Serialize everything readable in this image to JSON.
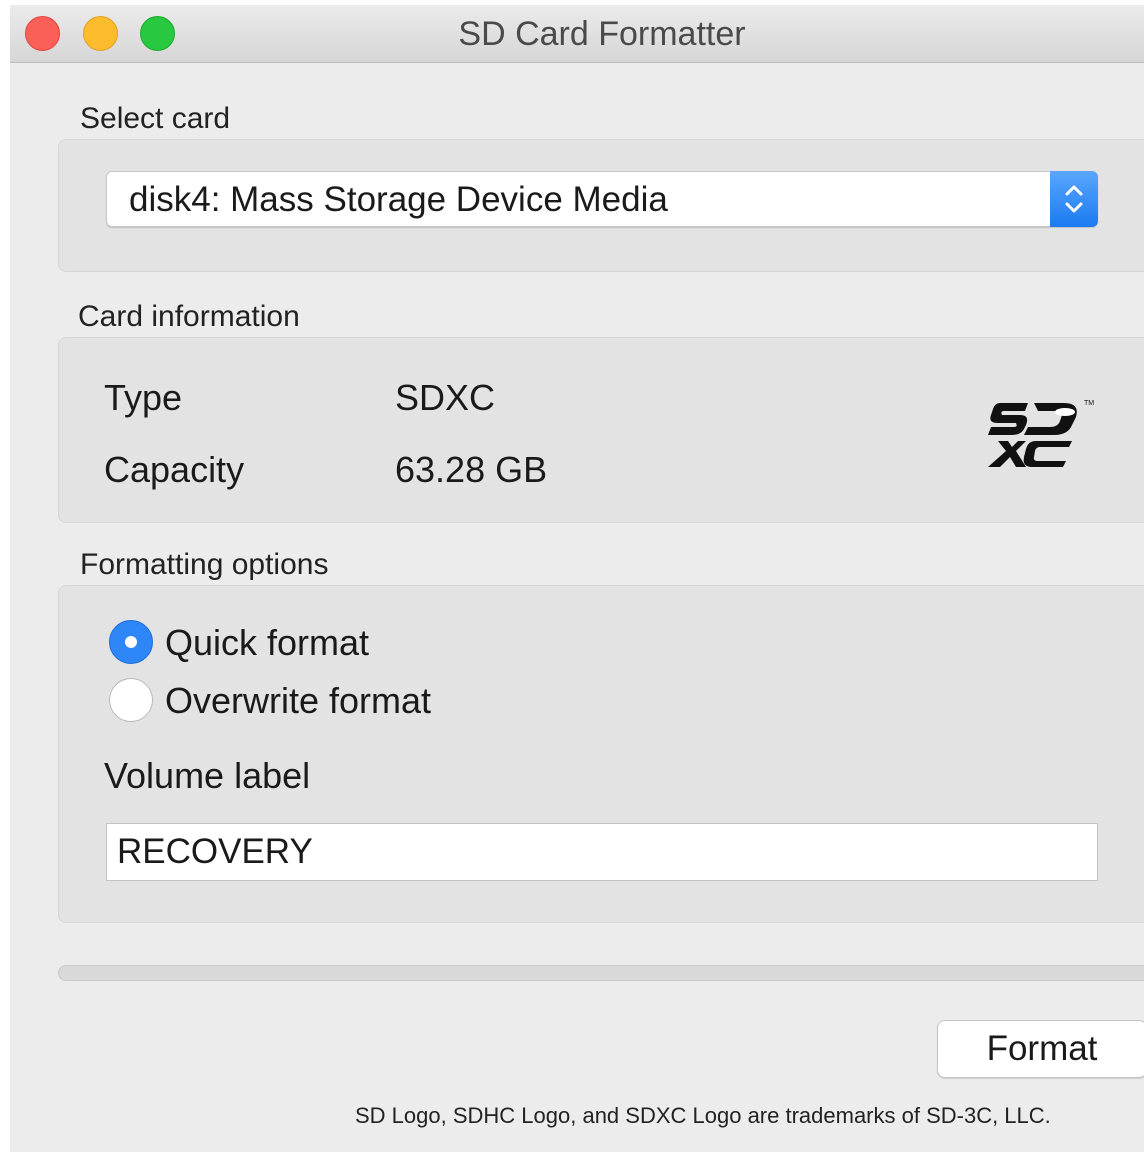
{
  "window": {
    "title": "SD Card Formatter",
    "controls": [
      "close",
      "minimize",
      "zoom"
    ]
  },
  "select_card": {
    "label": "Select card",
    "selected": "disk4: Mass Storage Device Media"
  },
  "card_information": {
    "label": "Card information",
    "type_label": "Type",
    "type_value": "SDXC",
    "capacity_label": "Capacity",
    "capacity_value": "63.28 GB",
    "logo_icon": "sdxc-logo-icon"
  },
  "formatting_options": {
    "label": "Formatting options",
    "options": [
      {
        "label": "Quick format",
        "selected": true
      },
      {
        "label": "Overwrite format",
        "selected": false
      }
    ],
    "volume_label_title": "Volume label",
    "volume_label_value": "RECOVERY"
  },
  "progress": {
    "value": 0
  },
  "actions": {
    "format_label": "Format"
  },
  "footer": {
    "trademark": "SD Logo, SDHC Logo, and SDXC Logo are trademarks of SD-3C, LLC."
  },
  "colors": {
    "accent": "#2f86f6",
    "close": "#fc5f57",
    "minimize": "#fdbc2e",
    "zoom": "#28c840"
  }
}
